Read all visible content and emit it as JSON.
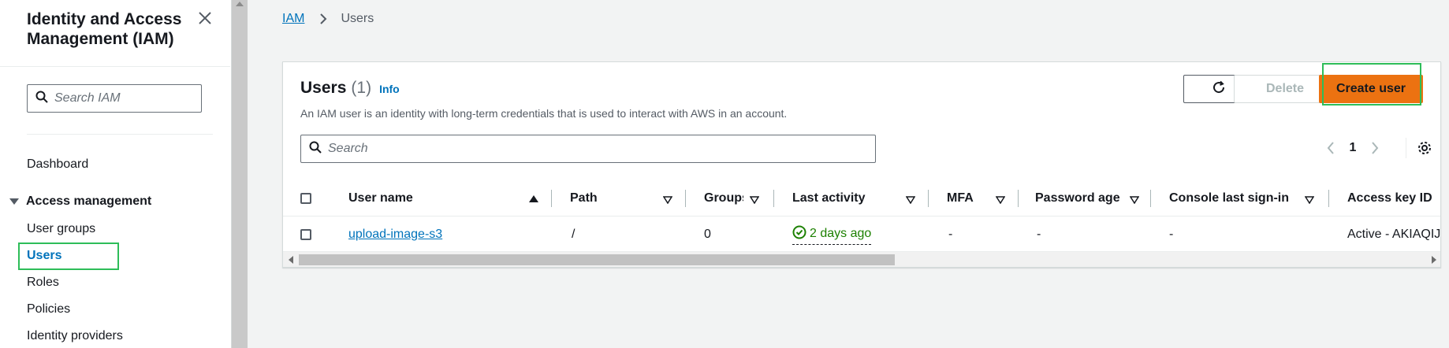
{
  "sidebar": {
    "title": "Identity and Access Management (IAM)",
    "search_placeholder": "Search IAM",
    "dashboard_label": "Dashboard",
    "group_label": "Access management",
    "items": [
      {
        "label": "User groups"
      },
      {
        "label": "Users"
      },
      {
        "label": "Roles"
      },
      {
        "label": "Policies"
      },
      {
        "label": "Identity providers"
      }
    ]
  },
  "breadcrumb": {
    "root": "IAM",
    "current": "Users"
  },
  "panel": {
    "title": "Users",
    "count": "(1)",
    "info_label": "Info",
    "description": "An IAM user is an identity with long-term credentials that is used to interact with AWS in an account.",
    "delete_label": "Delete",
    "create_label": "Create user",
    "search_placeholder": "Search",
    "page_number": "1"
  },
  "table": {
    "columns": [
      {
        "label": "User name"
      },
      {
        "label": "Path"
      },
      {
        "label": "Groups"
      },
      {
        "label": "Last activity"
      },
      {
        "label": "MFA"
      },
      {
        "label": "Password age"
      },
      {
        "label": "Console last sign-in"
      },
      {
        "label": "Access key ID"
      }
    ],
    "rows": [
      {
        "user_name": "upload-image-s3",
        "path": "/",
        "groups": "0",
        "last_activity": "2 days ago",
        "mfa": "-",
        "password_age": "-",
        "console_last_sign_in": "-",
        "access_key_id": "Active - AKIAQIJF"
      }
    ]
  },
  "colors": {
    "accent_link": "#0073bb",
    "primary_button": "#ec7211",
    "highlight_box": "#2ebd59",
    "success_text": "#1d8102"
  }
}
